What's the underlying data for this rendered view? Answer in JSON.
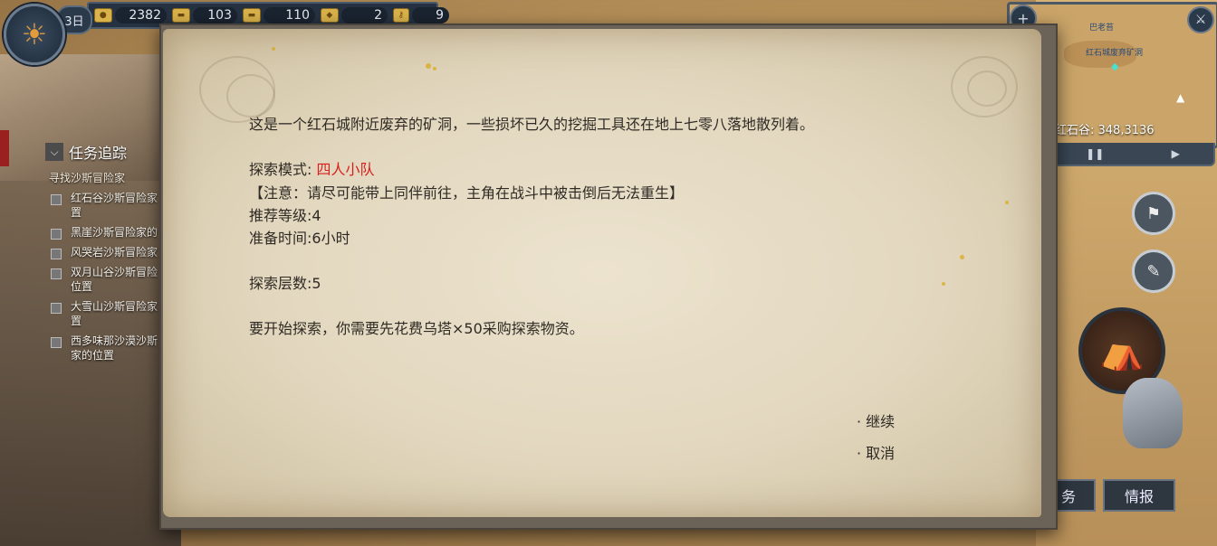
{
  "hud": {
    "day": "3日",
    "resources": [
      {
        "icon": "coin-icon",
        "value": "2382"
      },
      {
        "icon": "gold-bar-icon",
        "value": "103"
      },
      {
        "icon": "silver-bar-icon",
        "value": "110"
      },
      {
        "icon": "gem-icon",
        "value": "2"
      },
      {
        "icon": "key-icon",
        "value": "9"
      }
    ]
  },
  "quest_tracker": {
    "title": "任务追踪",
    "subtitle": "寻找沙斯冒险家",
    "items": [
      "红石谷沙斯冒险家\n置",
      "黑崖沙斯冒险家的",
      "风哭岩沙斯冒险家",
      "双月山谷沙斯冒险\n位置",
      "大雪山沙斯冒险家\n置",
      "西多味那沙漠沙斯\n家的位置"
    ]
  },
  "minimap": {
    "coord": "红石谷: 348,3136",
    "labels": [
      "巴老苔",
      "红石城废弃矿洞"
    ]
  },
  "dialog": {
    "description": "这是一个红石城附近废弃的矿洞，一些损坏已久的挖掘工具还在地上七零八落地散列着。",
    "mode_label": "探索模式: ",
    "mode_value": "四人小队",
    "notice": "【注意：请尽可能带上同伴前往，主角在战斗中被击倒后无法重生】",
    "recommended_level": "推荐等级:4",
    "prep_time": "准备时间:6小时",
    "floors": "探索层数:5",
    "cost": "要开始探索，你需要先花费乌塔×50采购探索物资。",
    "choices": [
      "· 继续",
      "· 取消"
    ]
  },
  "tabs": [
    "务",
    "情报"
  ]
}
